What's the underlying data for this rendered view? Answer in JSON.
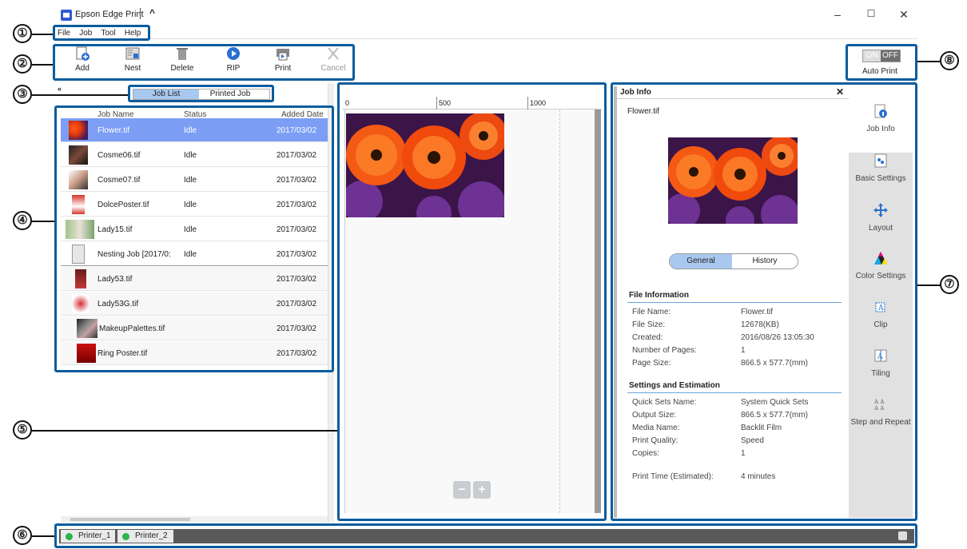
{
  "window": {
    "title": "Epson Edge Print",
    "caret": "^",
    "minimize": "–",
    "maximize": "☐",
    "close": "✕"
  },
  "menu": [
    "File",
    "Job",
    "Tool",
    "Help"
  ],
  "toolbar": {
    "add": "Add",
    "nest": "Nest",
    "delete": "Delete",
    "rip": "RIP",
    "print": "Print",
    "cancel": "Cancel"
  },
  "auto_print": {
    "on": "ON",
    "off": "OFF",
    "label": "Auto Print"
  },
  "callouts": [
    "①",
    "②",
    "③",
    "④",
    "⑤",
    "⑥",
    "⑦",
    "⑧"
  ],
  "collapse": "«",
  "job_tabs": {
    "job_list": "Job List",
    "printed_job": "Printed Job"
  },
  "columns": {
    "name": "Job Name",
    "status": "Status",
    "date": "Added Date"
  },
  "jobs": [
    {
      "name": "Flower.tif",
      "status": "Idle",
      "date": "2017/03/02"
    },
    {
      "name": "Cosme06.tif",
      "status": "Idle",
      "date": "2017/03/02"
    },
    {
      "name": "Cosme07.tif",
      "status": "Idle",
      "date": "2017/03/02"
    },
    {
      "name": "DolcePoster.tif",
      "status": "Idle",
      "date": "2017/03/02"
    },
    {
      "name": "Lady15.tif",
      "status": "Idle",
      "date": "2017/03/02"
    },
    {
      "name": "Nesting Job [2017/0:",
      "status": "Idle",
      "date": "2017/03/02"
    },
    {
      "name": "Lady53.tif",
      "status": "",
      "date": "2017/03/02"
    },
    {
      "name": "Lady53G.tif",
      "status": "",
      "date": "2017/03/02"
    },
    {
      "name": "MakeupPalettes.tif",
      "status": "",
      "date": "2017/03/02"
    },
    {
      "name": "Ring Poster.tif",
      "status": "",
      "date": "2017/03/02"
    }
  ],
  "ruler": {
    "t0": "0",
    "t500": "500",
    "t1000": "1000"
  },
  "zoom": {
    "out": "−",
    "in": "+"
  },
  "job_info": {
    "header": "Job Info",
    "close": "✕",
    "file": "Flower.tif",
    "tabs": {
      "general": "General",
      "history": "History"
    },
    "file_info_title": "File Information",
    "file_info": [
      {
        "label": "File Name:",
        "value": "Flower.tif"
      },
      {
        "label": "File Size:",
        "value": "12678(KB)"
      },
      {
        "label": "Created:",
        "value": "2016/08/26 13:05:30"
      },
      {
        "label": "Number of Pages:",
        "value": "1"
      },
      {
        "label": "Page Size:",
        "value": "866.5 x 577.7(mm)"
      }
    ],
    "settings_title": "Settings and Estimation",
    "settings": [
      {
        "label": "Quick Sets Name:",
        "value": "System Quick Sets"
      },
      {
        "label": "Output Size:",
        "value": "866.5 x 577.7(mm)"
      },
      {
        "label": "Media Name:",
        "value": "Backlit Film"
      },
      {
        "label": "Print Quality:",
        "value": "Speed"
      },
      {
        "label": "Copies:",
        "value": "1"
      }
    ],
    "print_time": {
      "label": "Print Time (Estimated):",
      "value": "4 minutes"
    }
  },
  "side_panel": [
    "Job Info",
    "Basic Settings",
    "Layout",
    "Color Settings",
    "Clip",
    "Tiling",
    "Step and Repeat"
  ],
  "printers": [
    "Printer_1",
    "Printer_2"
  ]
}
